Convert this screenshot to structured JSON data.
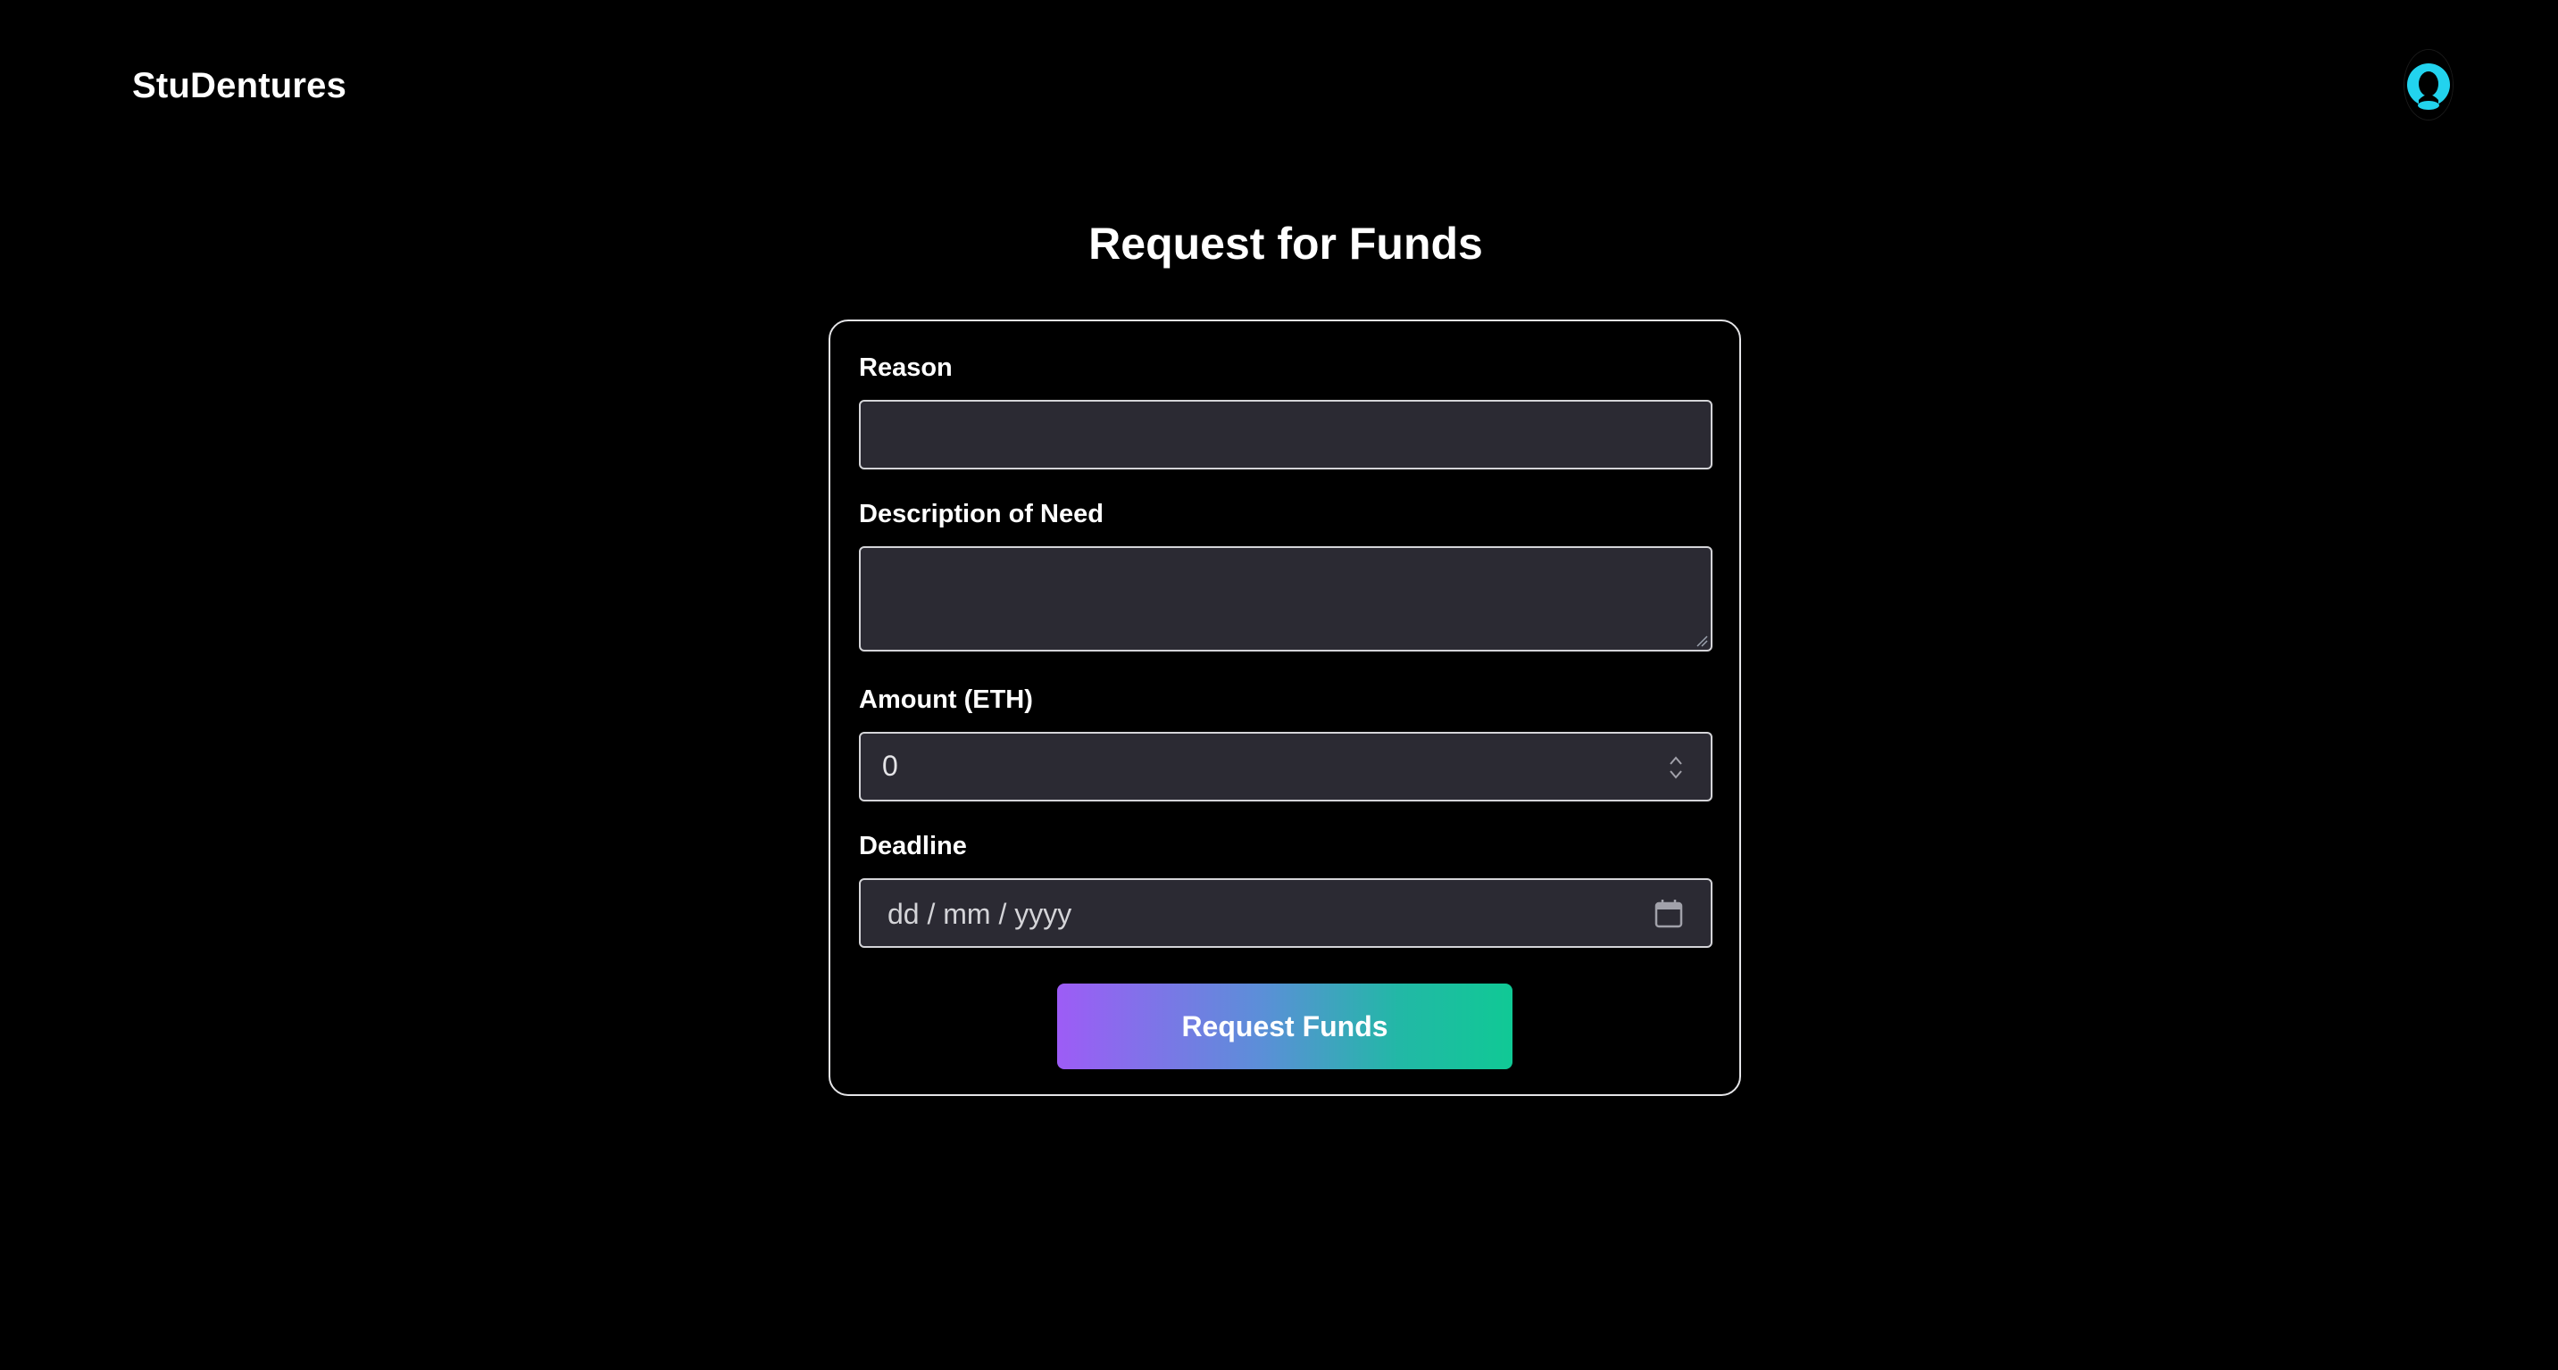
{
  "header": {
    "brand": "StuDentures",
    "avatar_icon": "user-avatar-icon",
    "avatar_color": "#22d3ee"
  },
  "main": {
    "title": "Request for Funds"
  },
  "form": {
    "reason": {
      "label": "Reason",
      "value": ""
    },
    "description": {
      "label": "Description of Need",
      "value": ""
    },
    "amount": {
      "label": "Amount (ETH)",
      "value": "0",
      "icon": "spinner-arrows-icon"
    },
    "deadline": {
      "label": "Deadline",
      "placeholder": "dd / mm / yyyy",
      "icon": "calendar-icon"
    },
    "submit_label": "Request Funds",
    "submit_gradient": [
      "#9d5cf6",
      "#10c995"
    ]
  },
  "colors": {
    "background": "#000000",
    "field_background": "#2b2a33",
    "field_border": "#d4d4d8",
    "card_border": "#e4e4e7"
  }
}
